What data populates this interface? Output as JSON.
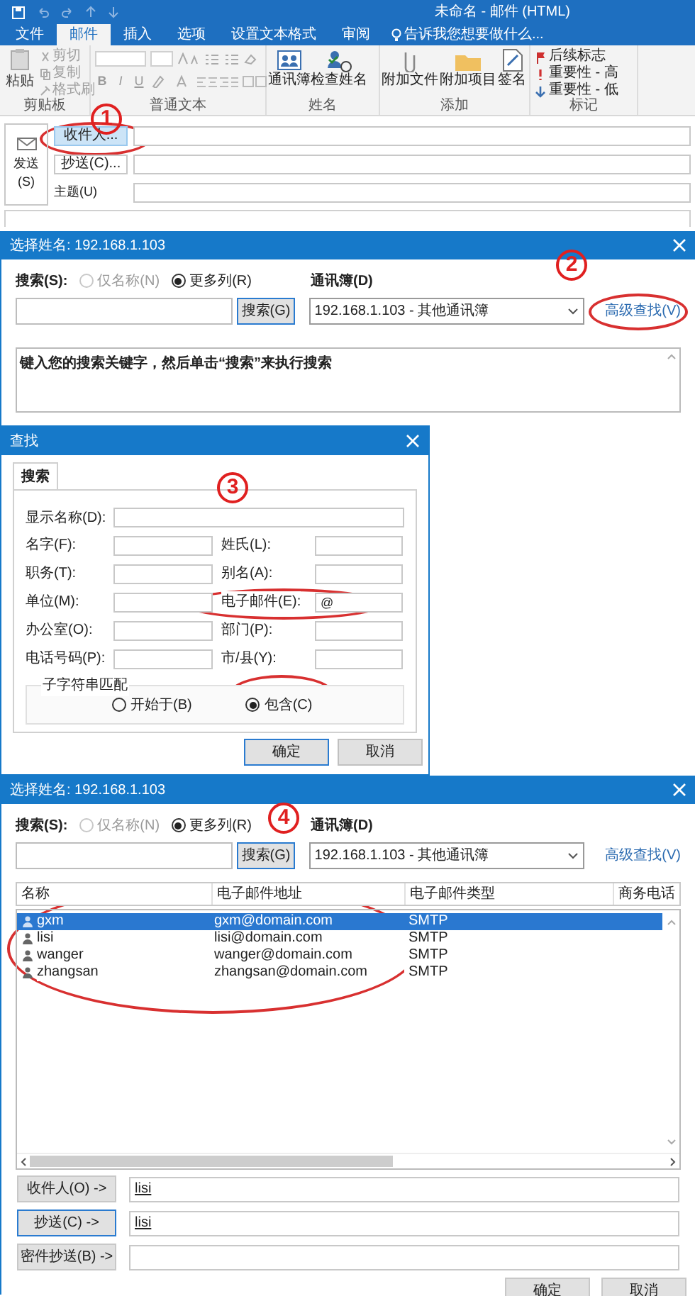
{
  "compose": {
    "window_title": "未命名 - 邮件 (HTML)",
    "tabs": [
      {
        "label": "文件",
        "selected": false
      },
      {
        "label": "邮件",
        "selected": true
      },
      {
        "label": "插入",
        "selected": false
      },
      {
        "label": "选项",
        "selected": false
      },
      {
        "label": "设置文本格式",
        "selected": false
      },
      {
        "label": "审阅",
        "selected": false
      }
    ],
    "tell_me": "告诉我您想要做什么...",
    "clipboard": {
      "paste": "粘贴",
      "items": [
        {
          "label": "剪切",
          "disabled": true
        },
        {
          "label": "复制",
          "disabled": true
        },
        {
          "label": "格式刷",
          "disabled": true
        }
      ],
      "group_label": "剪贴板"
    },
    "basic_text": {
      "format_buttons": [
        "B",
        "I",
        "U"
      ],
      "group_label": "普通文本"
    },
    "names": {
      "buttons": [
        "通讯簿",
        "检查姓名"
      ],
      "group_label": "姓名"
    },
    "include": {
      "buttons": [
        "附加文件",
        "附加项目",
        "签名"
      ],
      "group_label": "添加"
    },
    "tags": {
      "items": [
        {
          "kind": "flag",
          "label": "后续标志"
        },
        {
          "kind": "high",
          "label": "重要性 - 高"
        },
        {
          "kind": "low",
          "label": "重要性 - 低"
        }
      ],
      "group_label": "标记"
    },
    "send": "发送(S)",
    "to_button": "收件人...",
    "cc_button": "抄送(C)...",
    "subject_label": "主题(U)",
    "annotation": "1"
  },
  "select_names_1": {
    "title": "选择姓名: 192.168.1.103",
    "search_label": "搜索(S):",
    "radios": [
      {
        "label": "仅名称(N)",
        "selected": false,
        "disabled": true
      },
      {
        "label": "更多列(R)",
        "selected": true,
        "disabled": false
      }
    ],
    "search_button": "搜索(G)",
    "address_book_label": "通讯簿(D)",
    "address_book": "192.168.1.103 - 其他通讯簿",
    "advanced_link": "高级查找(V)",
    "hint": "键入您的搜索关键字，然后单击“搜索”来执行搜索",
    "annotation": "2"
  },
  "find": {
    "title": "查找",
    "tab": "搜索",
    "annotation": "3",
    "full_field": {
      "label": "显示名称(D):"
    },
    "fields": [
      {
        "label": "名字(F):"
      },
      {
        "label": "姓氏(L):"
      },
      {
        "label": "职务(T):"
      },
      {
        "label": "别名(A):"
      },
      {
        "label": "单位(M):"
      },
      {
        "label": "电子邮件(E):",
        "value": "@"
      },
      {
        "label": "办公室(O):"
      },
      {
        "label": "部门(P):"
      },
      {
        "label": "电话号码(P):"
      },
      {
        "label": "市/县(Y):"
      }
    ],
    "match_label": "子字符串匹配",
    "match_options": [
      {
        "label": "开始于(B)",
        "selected": false
      },
      {
        "label": "包含(C)",
        "selected": true
      }
    ],
    "buttons": [
      "确定",
      "取消"
    ]
  },
  "select_names_2": {
    "title": "选择姓名: 192.168.1.103",
    "search_label": "搜索(S):",
    "annotation": "4",
    "radios": [
      {
        "label": "仅名称(N)",
        "selected": false,
        "disabled": true
      },
      {
        "label": "更多列(R)",
        "selected": true,
        "disabled": false
      }
    ],
    "search_button": "搜索(G)",
    "address_book_label": "通讯簿(D)",
    "address_book": "192.168.1.103 - 其他通讯簿",
    "advanced_link": "高级查找(V)",
    "columns": [
      "名称",
      "电子邮件地址",
      "电子邮件类型",
      "商务电话"
    ],
    "rows": [
      {
        "name": "gxm",
        "email": "gxm@domain.com",
        "type": "SMTP",
        "selected": true
      },
      {
        "name": "lisi",
        "email": "lisi@domain.com",
        "type": "SMTP",
        "selected": false
      },
      {
        "name": "wanger",
        "email": "wanger@domain.com",
        "type": "SMTP",
        "selected": false
      },
      {
        "name": "zhangsan",
        "email": "zhangsan@domain.com",
        "type": "SMTP",
        "selected": false
      }
    ],
    "recipients": [
      {
        "button": "收件人(O) ->",
        "value": "lisi"
      },
      {
        "button": "抄送(C) ->",
        "value": "lisi"
      },
      {
        "button": "密件抄送(B) ->"
      }
    ],
    "buttons": [
      "确定",
      "取消"
    ]
  }
}
